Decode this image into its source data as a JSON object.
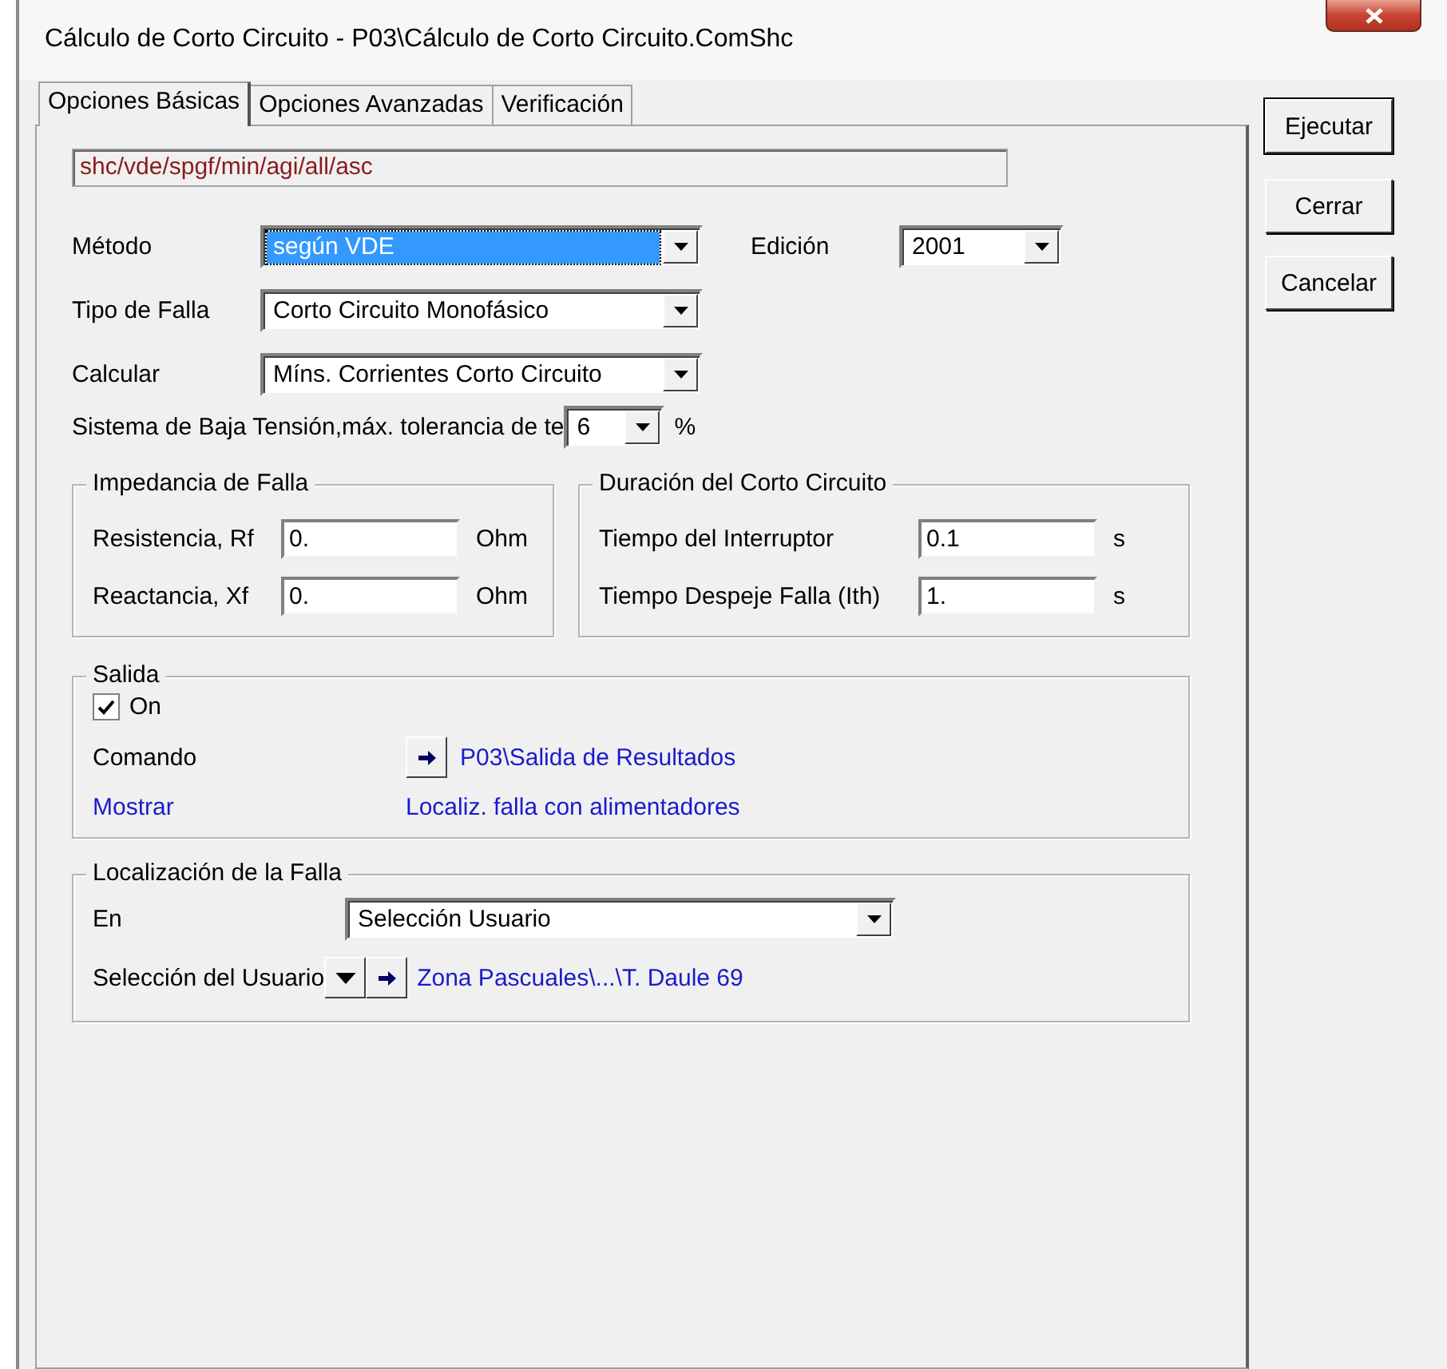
{
  "window": {
    "title": "Cálculo de Corto Circuito - P03\\Cálculo de Corto Circuito.ComShc"
  },
  "tabs": [
    {
      "label": "Opciones Básicas",
      "selected": true
    },
    {
      "label": "Opciones Avanzadas",
      "selected": false
    },
    {
      "label": "Verificación",
      "selected": false
    }
  ],
  "command_line": "shc/vde/spgf/min/agi/all/asc",
  "settings": [
    {
      "label": "Método",
      "value": "según VDE",
      "focused": true
    },
    {
      "label": "Tipo de Falla",
      "value": "Corto Circuito Monofásico",
      "focused": false
    },
    {
      "label": "Calcular",
      "value": "Míns. Corrientes Corto Circuito",
      "focused": false
    }
  ],
  "edition": {
    "label": "Edición",
    "value": "2001"
  },
  "low_voltage": {
    "label": "Sistema de Baja Tensión,máx. tolerancia de te",
    "value": "6",
    "unit": "%"
  },
  "groups": [
    {
      "title": "Impedancia de Falla",
      "rows": [
        {
          "label": "Resistencia, Rf",
          "value": "0.",
          "unit": "Ohm"
        },
        {
          "label": "Reactancia, Xf",
          "value": "0.",
          "unit": "Ohm"
        }
      ]
    },
    {
      "title": "Duración del Corto Circuito",
      "rows": [
        {
          "label": "Tiempo del Interruptor",
          "value": "0.1",
          "unit": "s"
        },
        {
          "label": "Tiempo Despeje Falla (Ith)",
          "value": "1.",
          "unit": "s"
        }
      ]
    }
  ],
  "output": {
    "title": "Salida",
    "checkbox": {
      "label": "On",
      "checked": true
    },
    "command_label": "Comando",
    "command_value": "P03\\Salida de Resultados",
    "show_label": "Mostrar",
    "show_value": "Localiz. falla con alimentadores"
  },
  "fault_location": {
    "title": "Localización de la Falla",
    "at_label": "En",
    "at_value": "Selección Usuario",
    "selection_label": "Selección del Usuario",
    "selection_value": "Zona Pascuales\\...\\T. Daule 69"
  },
  "buttons": [
    "Ejecutar",
    "Cerrar",
    "Cancelar"
  ]
}
